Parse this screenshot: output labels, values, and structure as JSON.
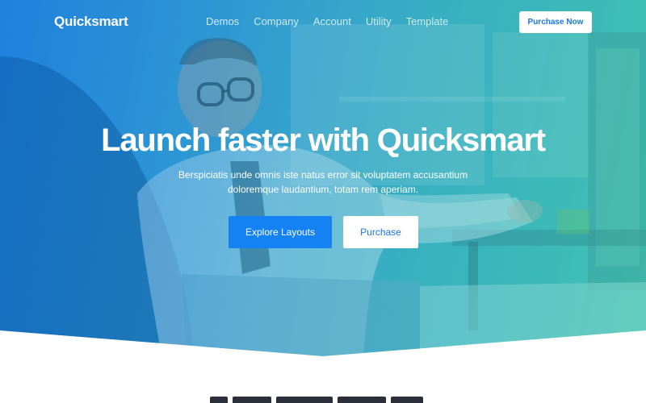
{
  "brand": {
    "logo_text": "Quicksmart"
  },
  "nav": {
    "links": [
      {
        "label": "Demos"
      },
      {
        "label": "Company"
      },
      {
        "label": "Account"
      },
      {
        "label": "Utility"
      },
      {
        "label": "Template"
      }
    ],
    "cta_label": "Purchase Now"
  },
  "hero": {
    "title": "Launch faster with Quicksmart",
    "subtitle_line1": "Berspiciatis unde omnis iste natus error sit voluptatem accusantium",
    "subtitle_line2": "doloremque laudantium, totam rem aperiam.",
    "primary_button": "Explore Layouts",
    "secondary_button": "Purchase"
  },
  "colors": {
    "accent": "#1582f4",
    "gradient_start": "#1a7fe0",
    "gradient_end": "#3cc9ad",
    "text_on_hero": "#ffffff"
  }
}
